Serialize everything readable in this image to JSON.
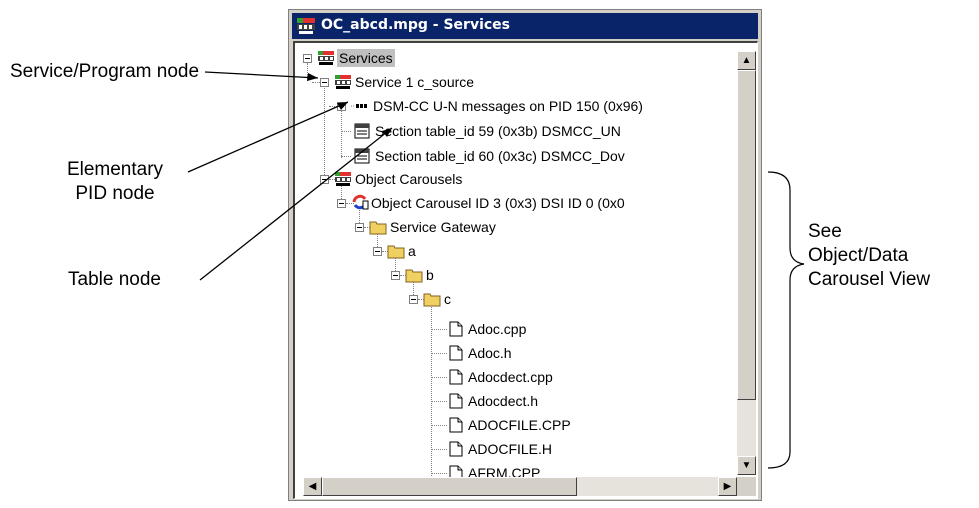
{
  "annotations": {
    "service_program_node": "Service/Program node",
    "elementary_pid_node_line1": "Elementary",
    "elementary_pid_node_line2": "PID node",
    "table_node": "Table node",
    "see_line1": "See",
    "see_line2": "Object/Data",
    "see_line3": "Carousel View"
  },
  "window": {
    "title": "OC_abcd.mpg - Services"
  },
  "tree": {
    "services": "Services",
    "service1": "Service 1 c_source",
    "dsmcc": "DSM-CC U-N messages on PID 150 (0x96)",
    "section59": "Section table_id 59 (0x3b) DSMCC_UN",
    "section60": "Section table_id 60 (0x3c) DSMCC_Dov",
    "object_carousels": "Object Carousels",
    "carousel": "Object Carousel ID 3 (0x3) DSI ID 0 (0x0",
    "service_gateway": "Service Gateway",
    "folder_a": "a",
    "folder_b": "b",
    "folder_c": "c",
    "files": [
      "Adoc.cpp",
      "Adoc.h",
      "Adocdect.cpp",
      "Adocdect.h",
      "ADOCFILE.CPP",
      "ADOCFILE.H",
      "AFRM.CPP"
    ]
  },
  "icons": {
    "services": "service-icon",
    "service": "service-icon",
    "pid": "pid-icon",
    "table": "table-icon",
    "carousel": "carousel-icon",
    "folder": "folder-icon",
    "file": "file-icon",
    "scroll_up": "▲",
    "scroll_down": "▼",
    "scroll_left": "◀",
    "scroll_right": "▶"
  },
  "colors": {
    "titlebar": "#0a246a",
    "folder": "#f0d060",
    "selection": "#c0c0c0"
  }
}
